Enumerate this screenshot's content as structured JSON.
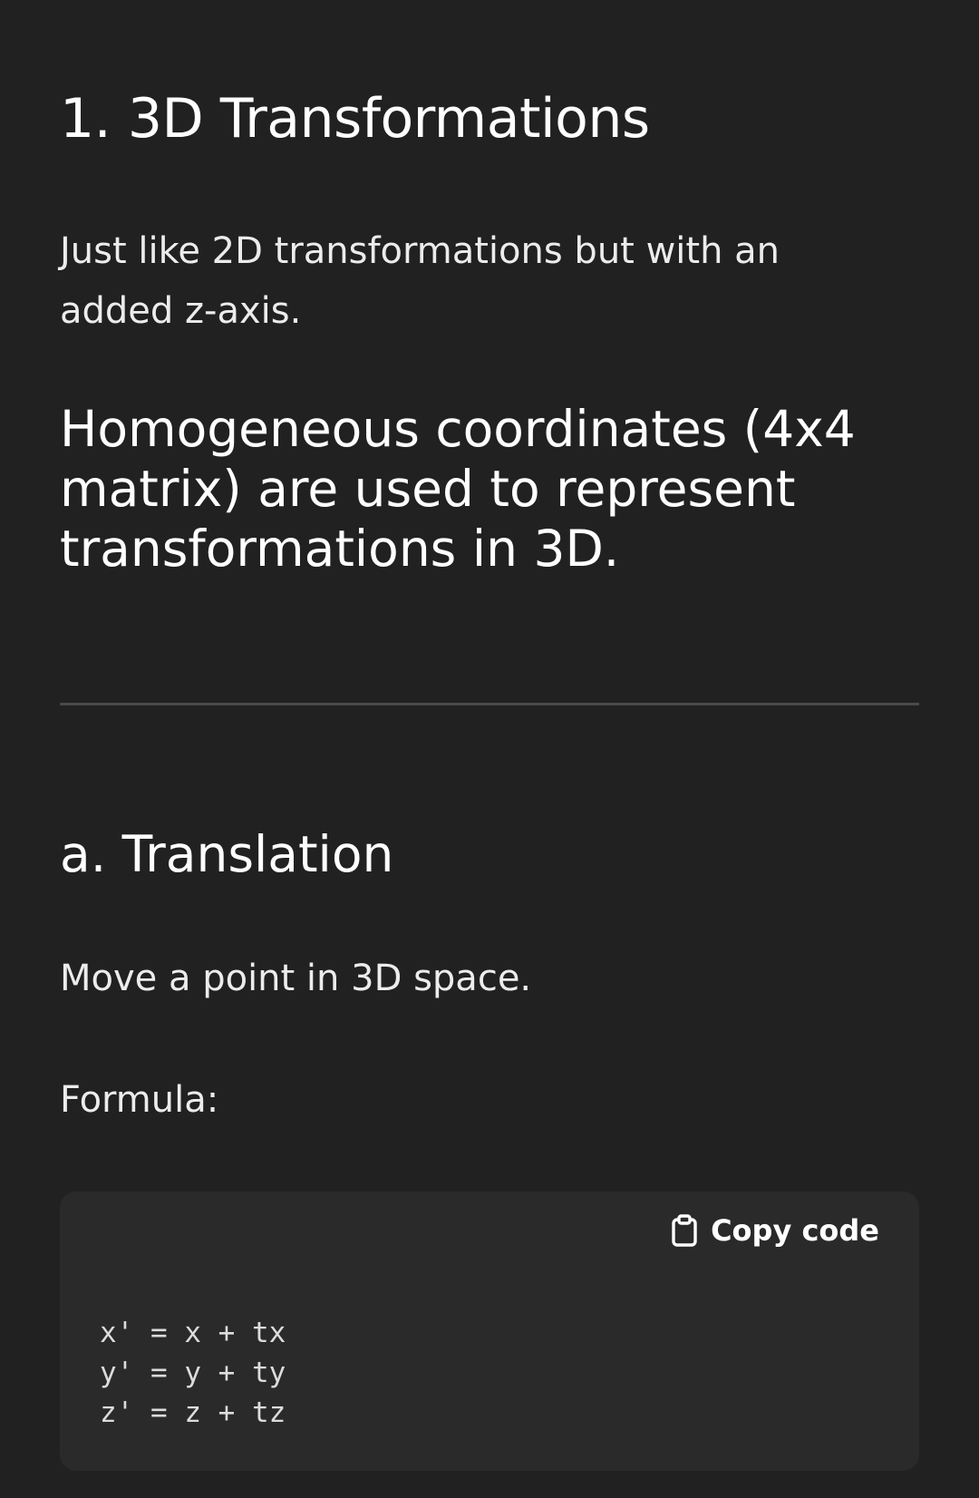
{
  "article": {
    "heading_1": "1. 3D Transformations",
    "intro_paragraph": "Just like 2D transformations but with an added z-axis.",
    "heading_homogeneous": "Homogeneous coordinates (4x4 matrix) are used to represent transformations in 3D.",
    "heading_translation": "a. Translation",
    "translation_description": "Move a point in 3D space.",
    "formula_label": "Formula:"
  },
  "code_block": {
    "copy_label": "Copy code",
    "copy_icon": "clipboard-icon",
    "lines": [
      "x' = x + tx",
      "y' = y + ty",
      "z' = z + tz"
    ]
  },
  "colors": {
    "background": "#212121",
    "code_background": "#2a2a2a",
    "text": "#ececec",
    "divider": "#4a4a4a"
  }
}
